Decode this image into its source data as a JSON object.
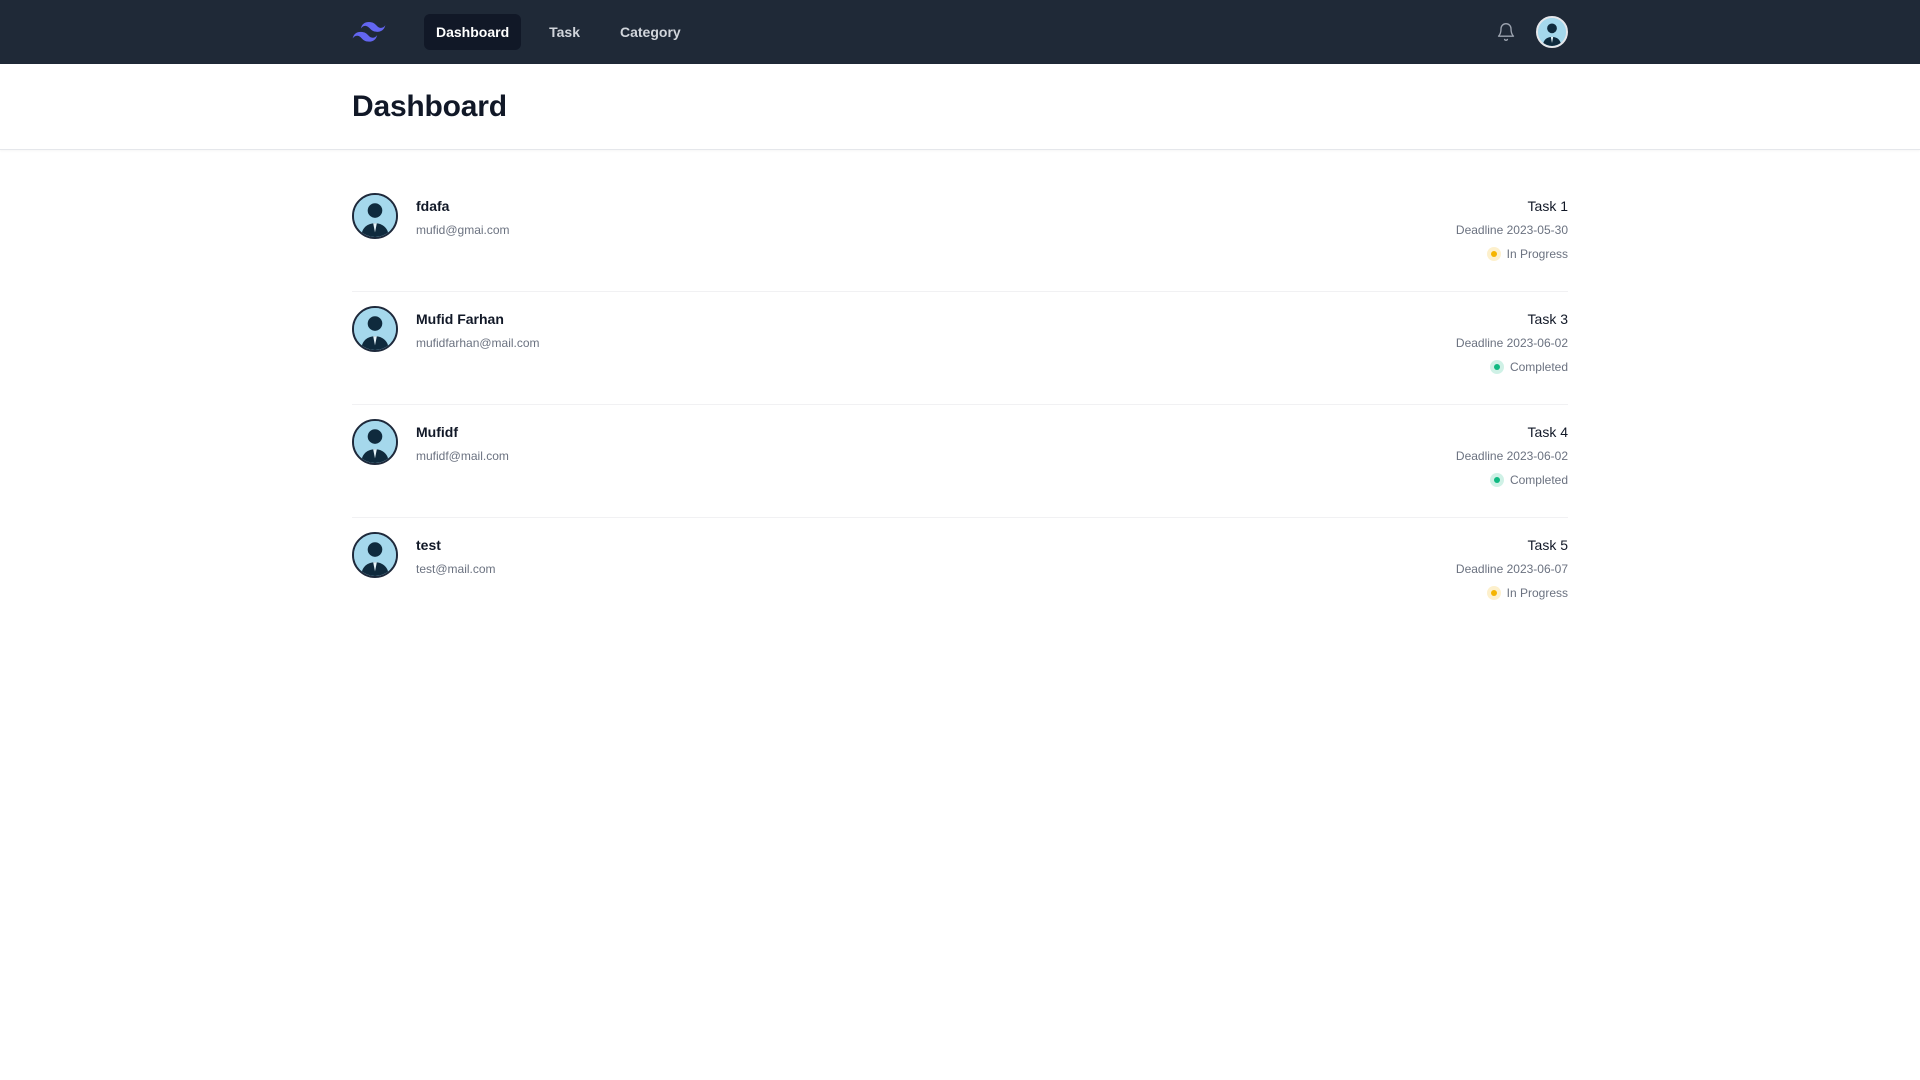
{
  "nav": {
    "brand_icon": "tailwind-logo-icon",
    "links": [
      {
        "label": "Dashboard",
        "active": true
      },
      {
        "label": "Task",
        "active": false
      },
      {
        "label": "Category",
        "active": false
      }
    ],
    "notification_icon": "bell-icon",
    "user_icon": "user-avatar"
  },
  "header": {
    "title": "Dashboard"
  },
  "colors": {
    "nav_bg": "#1f2937",
    "in_progress": "#f5b400",
    "completed": "#10b981",
    "brand": "#6366f1"
  },
  "tasks": [
    {
      "name": "fdafa",
      "email": "mufid@gmai.com",
      "task": "Task 1",
      "deadline": "Deadline 2023-05-30",
      "status": "In Progress",
      "status_color": "#f5b400"
    },
    {
      "name": "Mufid Farhan",
      "email": "mufidfarhan@mail.com",
      "task": "Task 3",
      "deadline": "Deadline 2023-06-02",
      "status": "Completed",
      "status_color": "#10b981"
    },
    {
      "name": "Mufidf",
      "email": "mufidf@mail.com",
      "task": "Task 4",
      "deadline": "Deadline 2023-06-02",
      "status": "Completed",
      "status_color": "#10b981"
    },
    {
      "name": "test",
      "email": "test@mail.com",
      "task": "Task 5",
      "deadline": "Deadline 2023-06-07",
      "status": "In Progress",
      "status_color": "#f5b400"
    }
  ]
}
